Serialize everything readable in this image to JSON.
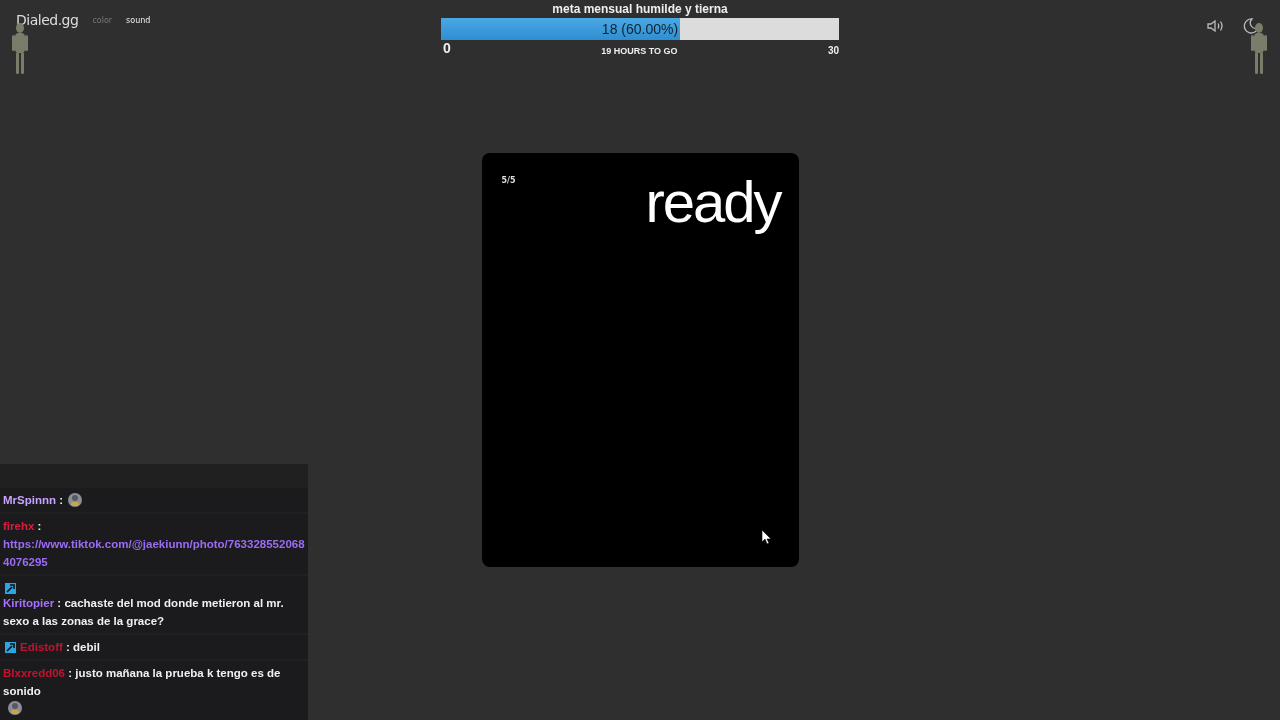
{
  "header": {
    "logo": "Dialed.gg",
    "nav": [
      {
        "label": "color",
        "selected": false
      },
      {
        "label": "sound",
        "selected": true
      }
    ]
  },
  "goal": {
    "title": "meta mensual humilde y tierna",
    "bar_text": "18 (60.00%)",
    "level": 0.6,
    "min": "0",
    "remaining": "19 HOURS TO GO",
    "max": "30"
  },
  "card": {
    "counter": "5/5",
    "word": "ready"
  },
  "chat": [
    {
      "user": "MrSpinnn",
      "color": "#c8a2ff",
      "badge": false,
      "separator": ":",
      "emote": true
    },
    {
      "user": "firehx",
      "color": "#d4213d",
      "badge": false,
      "separator": ":",
      "link": "https://www.tiktok.com/@jaekiunn/photo/7633285520684076295",
      "emote": false
    },
    {
      "user": "Kiritopier",
      "color": "#a970ff",
      "badge": true,
      "separator": ":",
      "text": "cachaste del mod donde metieron al mr. sexo a las zonas de la grace?",
      "emote": false
    },
    {
      "user": "Edistoff",
      "color": "#c4122f",
      "badge": true,
      "separator": ":",
      "text": "debil",
      "emote": false
    },
    {
      "user": "Blxxredd06",
      "color": "#c4122f",
      "badge": false,
      "separator": ":",
      "text": "justo mañana la prueba k tengo es de sonido",
      "emote": true
    }
  ]
}
